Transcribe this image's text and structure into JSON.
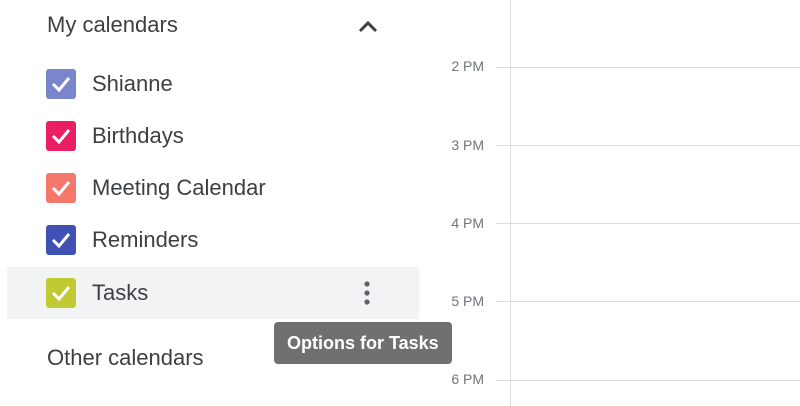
{
  "sidebar": {
    "my_calendars_title": "My calendars",
    "other_calendars_title": "Other calendars",
    "calendars": [
      {
        "label": "Shianne",
        "color": "#7986cb",
        "checked": true
      },
      {
        "label": "Birthdays",
        "color": "#e91e63",
        "checked": true
      },
      {
        "label": "Meeting Calendar",
        "color": "#f4776b",
        "checked": true
      },
      {
        "label": "Reminders",
        "color": "#3f51b5",
        "checked": true
      },
      {
        "label": "Tasks",
        "color": "#c0ca33",
        "checked": true
      }
    ],
    "hovered_calendar": "Tasks"
  },
  "tooltip": {
    "text": "Options for Tasks"
  },
  "time_grid": {
    "hours": [
      "2 PM",
      "3 PM",
      "4 PM",
      "5 PM",
      "6 PM"
    ]
  },
  "colors": {
    "text": "#3c4043",
    "muted_text": "#70757a",
    "gridline": "#dadce0",
    "hover_bg": "#f1f3f4",
    "tooltip_bg": "#707070"
  },
  "icons": {
    "collapse": "chevron-up-icon",
    "options": "more-vert-icon",
    "add": "plus-icon",
    "expand": "chevron-down-icon",
    "check": "check-icon"
  }
}
